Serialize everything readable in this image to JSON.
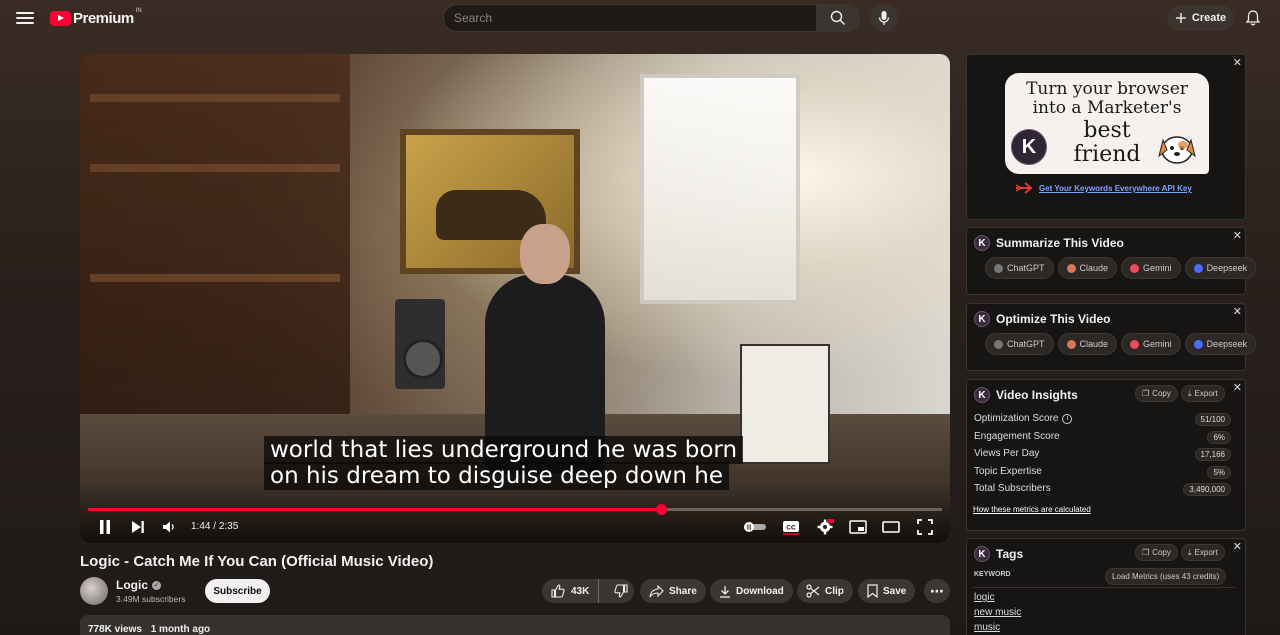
{
  "header": {
    "brand": "Premium",
    "country": "IN",
    "search_placeholder": "Search",
    "create_label": "Create"
  },
  "player": {
    "captions": [
      "world that lies underground he was born",
      "on his dream to disguise deep down he"
    ],
    "time_current": "1:44",
    "time_total": "2:35",
    "progress": 0.671
  },
  "video": {
    "title": "Logic - Catch Me If You Can (Official Music Video)",
    "channel": "Logic",
    "subscribers": "3.49M subscribers",
    "subscribe_label": "Subscribe",
    "likes": "43K",
    "share_label": "Share",
    "download_label": "Download",
    "clip_label": "Clip",
    "save_label": "Save",
    "views": "778K views",
    "posted": "1 month ago"
  },
  "sidebar": {
    "promo": {
      "banner_lines": [
        "Turn your browser",
        "into a Marketer's",
        "best",
        "friend"
      ],
      "link": "Get Your Keywords Everywhere API Key"
    },
    "summarize": {
      "title": "Summarize This Video",
      "buttons": [
        "ChatGPT",
        "Claude",
        "Gemini",
        "Deepseek"
      ]
    },
    "optimize": {
      "title": "Optimize This Video",
      "buttons": [
        "ChatGPT",
        "Claude",
        "Gemini",
        "Deepseek"
      ]
    },
    "insights": {
      "title": "Video Insights",
      "copy_label": "Copy",
      "export_label": "Export",
      "metrics": [
        {
          "label": "Optimization Score",
          "value": "51/100"
        },
        {
          "label": "Engagement Score",
          "value": "6%"
        },
        {
          "label": "Views Per Day",
          "value": "17,166"
        },
        {
          "label": "Topic Expertise",
          "value": "5%"
        },
        {
          "label": "Total Subscribers",
          "value": "3,490,000"
        }
      ],
      "link": "How these metrics are calculated"
    },
    "tags": {
      "title": "Tags",
      "copy_label": "Copy",
      "export_label": "Export",
      "column_label": "KEYWORD",
      "load_label": "Load Metrics (uses 43 credits)",
      "items": [
        "logic",
        "new music",
        "music"
      ]
    }
  },
  "colors": {
    "accent": "#ff0033",
    "claude": "#d97757",
    "gemini": "#ef4b5b",
    "deepseek": "#4d6bfe",
    "chatgpt": "#888888"
  }
}
